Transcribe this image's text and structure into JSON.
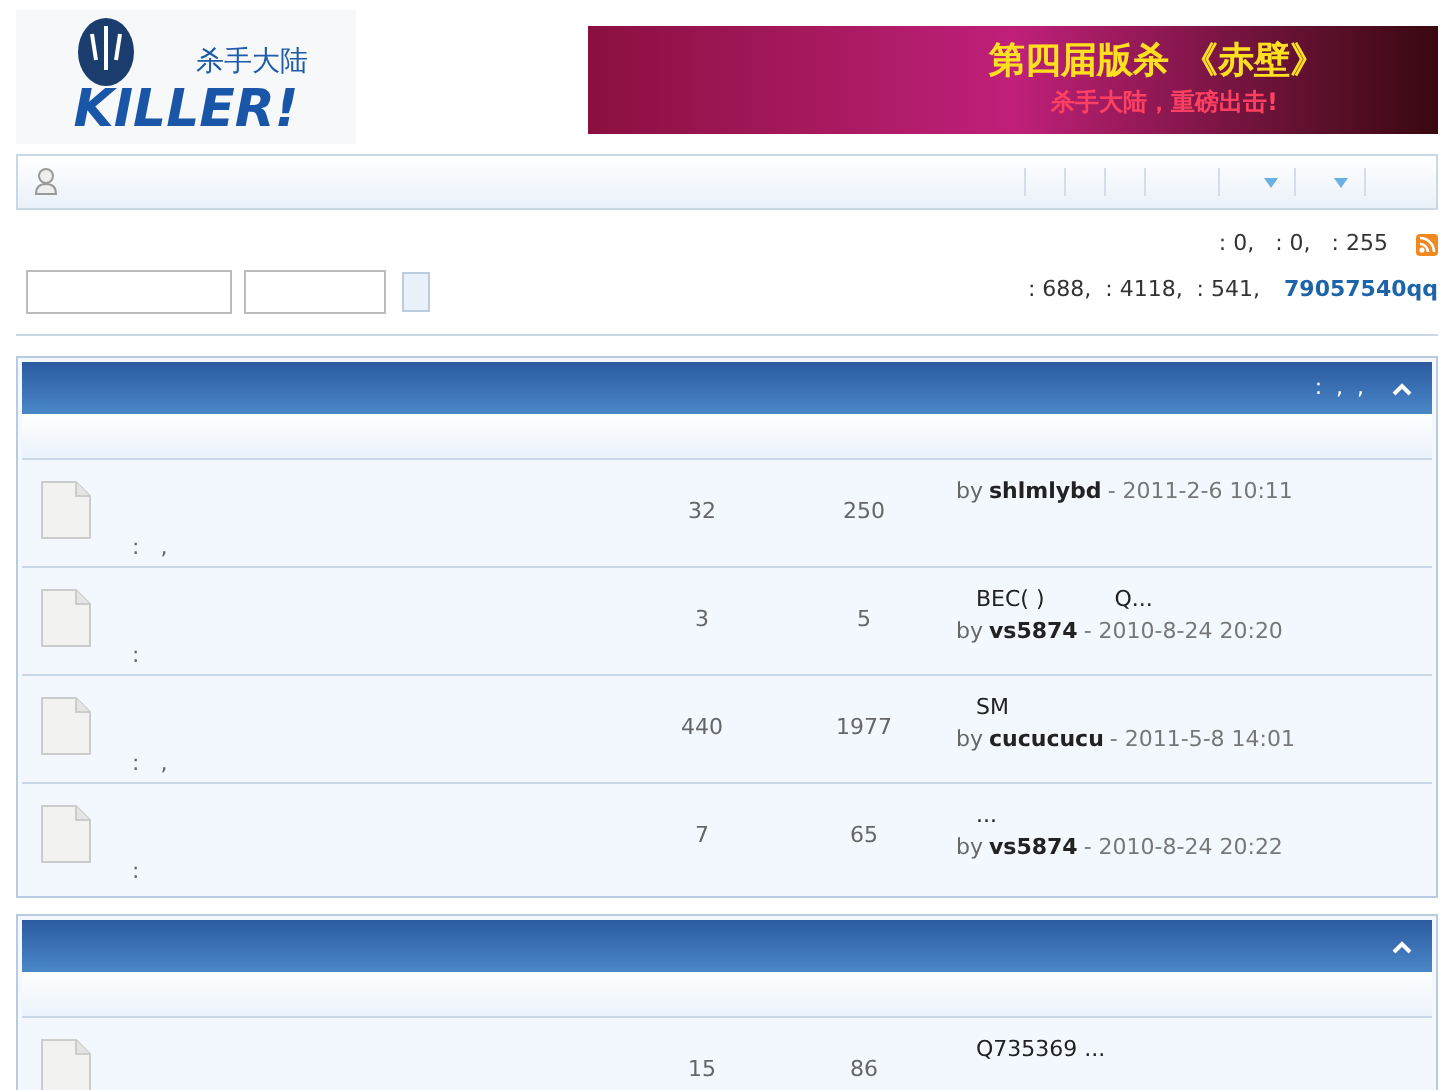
{
  "logo": {
    "chinese": "杀手大陆",
    "latin": "KILLER!"
  },
  "banner": {
    "headline": "第四届版杀 《赤壁》",
    "tagline": "杀手大陆，重磅出击!"
  },
  "stats": {
    "line_1": ": 0,   : 0,   : 255",
    "line_2": ": 688,  : 4118,  : 541,",
    "newest_member": "79057540qq"
  },
  "sections": [
    {
      "header_text": ":  ,  ,",
      "collapsed": false,
      "rows": [
        {
          "meta": ":   ,",
          "topics": "32",
          "posts": "250",
          "by": "by",
          "user": "shlmlybd",
          "date": "- 2011-2-6 10:11"
        },
        {
          "meta": ":",
          "topics": "3",
          "posts": "5",
          "last_title": "BEC( )          Q...",
          "by": "by",
          "user": "vs5874",
          "date": "- 2010-8-24 20:20"
        },
        {
          "meta": ":   ,",
          "topics": "440",
          "posts": "1977",
          "last_title": "SM",
          "by": "by",
          "user": "cucucucu",
          "date": "- 2011-5-8 14:01"
        },
        {
          "meta": ":",
          "topics": "7",
          "posts": "65",
          "last_title": "...",
          "by": "by",
          "user": "vs5874",
          "date": "- 2010-8-24 20:22"
        }
      ]
    },
    {
      "collapsed": false,
      "rows": [
        {
          "topics": "15",
          "posts": "86",
          "last_title": "Q735369 ..."
        }
      ]
    }
  ]
}
